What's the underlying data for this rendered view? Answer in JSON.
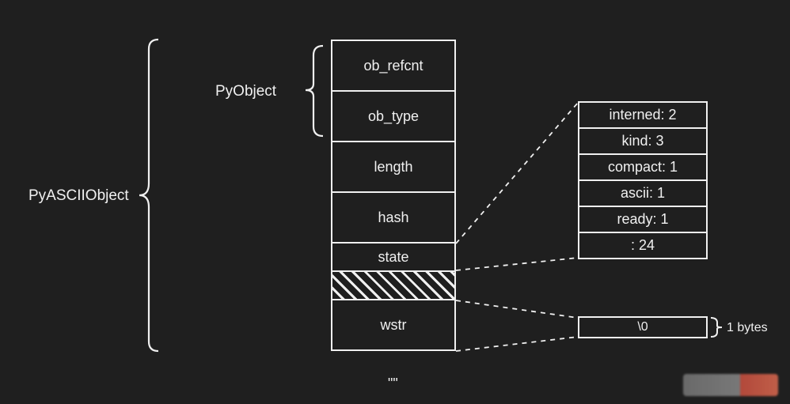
{
  "labels": {
    "pyascii": "PyASCIIObject",
    "pyobject": "PyObject",
    "bytes": "1 bytes",
    "bottom_quote": "\"\""
  },
  "main_cells": {
    "ob_refcnt": "ob_refcnt",
    "ob_type": "ob_type",
    "length": "length",
    "hash": "hash",
    "state": "state",
    "wstr": "wstr",
    "null_term": "\\0"
  },
  "state_cells": {
    "interned": "interned: 2",
    "kind": "kind: 3",
    "compact": "compact: 1",
    "ascii": "ascii: 1",
    "ready": "ready: 1",
    "padding": ": 24"
  }
}
